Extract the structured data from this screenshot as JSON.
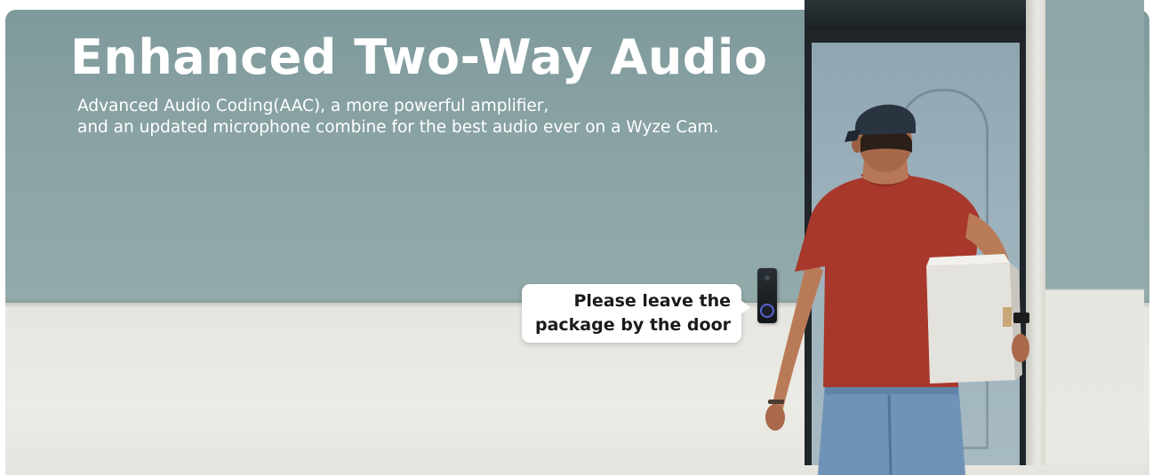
{
  "headline": "Enhanced Two-Way Audio",
  "subtitle": {
    "line1": "Advanced Audio Coding(AAC), a more powerful amplifier,",
    "line2": "and an updated microphone combine for the best audio ever on a Wyze Cam."
  },
  "speech_bubble": {
    "line1": "Please leave the",
    "line2": "package by the door"
  },
  "colors": {
    "wall_upper": "#8aa3a4",
    "wall_lower": "#ecebe6",
    "shirt": "#a8382b",
    "jeans": "#6f93b6",
    "doorbell_ring": "#5a64d8"
  }
}
